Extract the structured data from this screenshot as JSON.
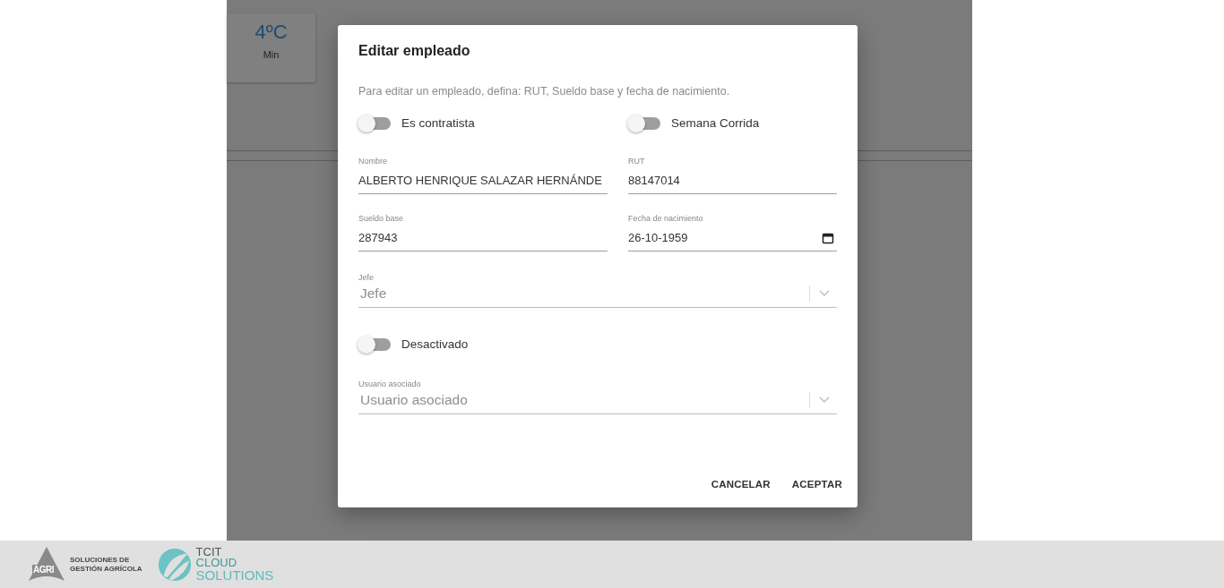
{
  "background_card": {
    "temperature": "4ºC",
    "label": "Min"
  },
  "dialog": {
    "title": "Editar empleado",
    "description": "Para editar un empleado, defina: RUT, Sueldo base y fecha de nacimiento.",
    "toggles_top": [
      {
        "label": "Es contratista",
        "on": false
      },
      {
        "label": "Semana Corrida",
        "on": false
      }
    ],
    "fields": [
      {
        "label": "Nombre",
        "value": "ALBERTO HENRIQUE SALAZAR HERNÁNDE",
        "kind": "text"
      },
      {
        "label": "RUT",
        "value": "88147014",
        "kind": "text"
      },
      {
        "label": "Sueldo base",
        "value": "287943",
        "kind": "text"
      },
      {
        "label": "Fecha de nacimiento",
        "value": "26-10-1959",
        "kind": "date"
      }
    ],
    "boss_select": {
      "label": "Jefe",
      "placeholder": "Jefe"
    },
    "deactivated_toggle": {
      "label": "Desactivado",
      "on": false
    },
    "user_select": {
      "label": "Usuario asociado",
      "placeholder": "Usuario asociado"
    },
    "buttons": [
      "CANCELAR",
      "ACEPTAR"
    ]
  },
  "footer": {
    "agri_logo": {
      "mark": "AGRI",
      "lines": [
        "SOLUCIONES DE",
        "GESTIÓN AGRÍCOLA"
      ]
    },
    "tcit_logo": {
      "lines": [
        "TCIT",
        "CLOUD",
        "SOLUTIONS"
      ]
    }
  }
}
